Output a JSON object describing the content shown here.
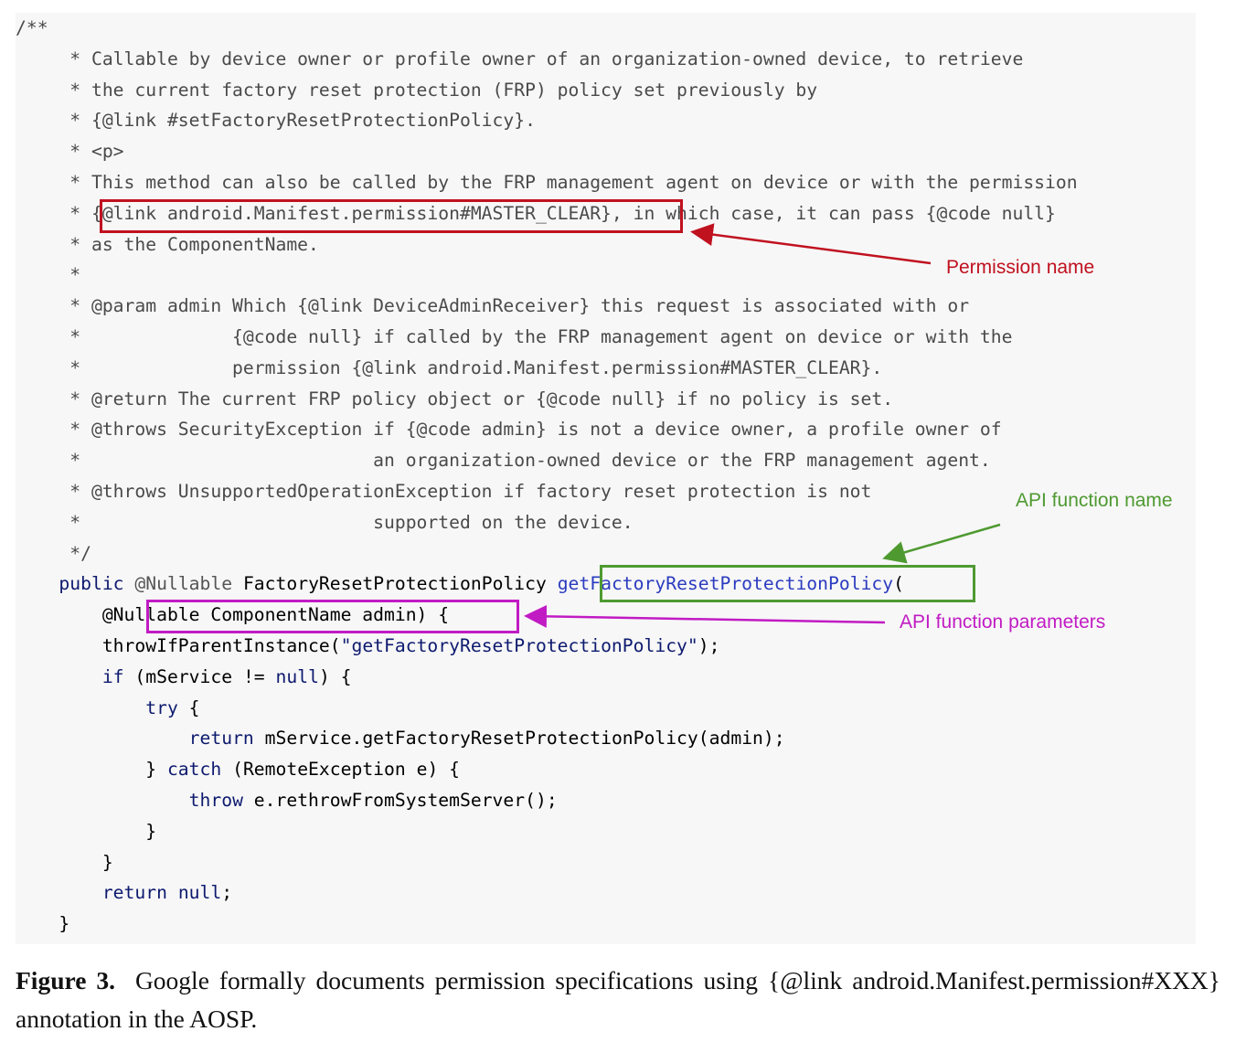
{
  "code_lines": [
    {
      "text": "/**",
      "type": "comment"
    },
    {
      "text": "     * Callable by device owner or profile owner of an organization-owned device, to retrieve",
      "type": "comment"
    },
    {
      "text": "     * the current factory reset protection (FRP) policy set previously by",
      "type": "comment"
    },
    {
      "text": "     * {@link #setFactoryResetProtectionPolicy}.",
      "type": "comment"
    },
    {
      "text": "     * <p>",
      "type": "comment"
    },
    {
      "text": "     * This method can also be called by the FRP management agent on device or with the permission",
      "type": "comment"
    },
    {
      "text": "     * {@link android.Manifest.permission#MASTER_CLEAR}, in which case, it can pass {@code null}",
      "type": "comment"
    },
    {
      "text": "     * as the ComponentName.",
      "type": "comment"
    },
    {
      "text": "     *",
      "type": "comment"
    },
    {
      "text": "     * @param admin Which {@link DeviceAdminReceiver} this request is associated with or",
      "type": "comment"
    },
    {
      "text": "     *              {@code null} if called by the FRP management agent on device or with the",
      "type": "comment"
    },
    {
      "text": "     *              permission {@link android.Manifest.permission#MASTER_CLEAR}.",
      "type": "comment"
    },
    {
      "text": "     * @return The current FRP policy object or {@code null} if no policy is set.",
      "type": "comment"
    },
    {
      "text": "     * @throws SecurityException if {@code admin} is not a device owner, a profile owner of",
      "type": "comment"
    },
    {
      "text": "     *                           an organization-owned device or the FRP management agent.",
      "type": "comment"
    },
    {
      "text": "     * @throws UnsupportedOperationException if factory reset protection is not",
      "type": "comment"
    },
    {
      "text": "     *                           supported on the device.",
      "type": "comment"
    },
    {
      "text": "     */",
      "type": "comment"
    },
    {
      "text": "",
      "type": "signature"
    },
    {
      "text": "",
      "type": "params"
    },
    {
      "text": "        throwIfParentInstance(\"getFactoryResetProtectionPolicy\");",
      "type": "code"
    },
    {
      "text": "        if (mService != null) {",
      "type": "code"
    },
    {
      "text": "            try {",
      "type": "code"
    },
    {
      "text": "                return mService.getFactoryResetProtectionPolicy(admin);",
      "type": "code"
    },
    {
      "text": "            } catch (RemoteException e) {",
      "type": "code"
    },
    {
      "text": "                throw e.rethrowFromSystemServer();",
      "type": "code"
    },
    {
      "text": "            }",
      "type": "code"
    },
    {
      "text": "        }",
      "type": "code"
    },
    {
      "text": "        return null;",
      "type": "code"
    },
    {
      "text": "    }",
      "type": "code"
    }
  ],
  "signature": {
    "prefix": "    public @Nullable FactoryResetProtectionPolicy ",
    "method_name": "getFactoryResetProtectionPolicy",
    "open_paren": "("
  },
  "params_line": {
    "indent": "        ",
    "params": "@Nullable ComponentName admin)",
    "tail": "{"
  },
  "callouts": {
    "permission_name": "Permission name",
    "api_function_name": "API function name",
    "api_function_parameters": "API function parameters"
  },
  "caption": {
    "label": "Figure 3.",
    "text": "Google formally documents permission specifications using {@link android.Manifest.permission#XXX} annotation in the AOSP."
  },
  "colors": {
    "permission": "#c0111f",
    "function_name": "#4e9a31",
    "parameters": "#c11bc4",
    "keyword": "#0d1a6e"
  }
}
